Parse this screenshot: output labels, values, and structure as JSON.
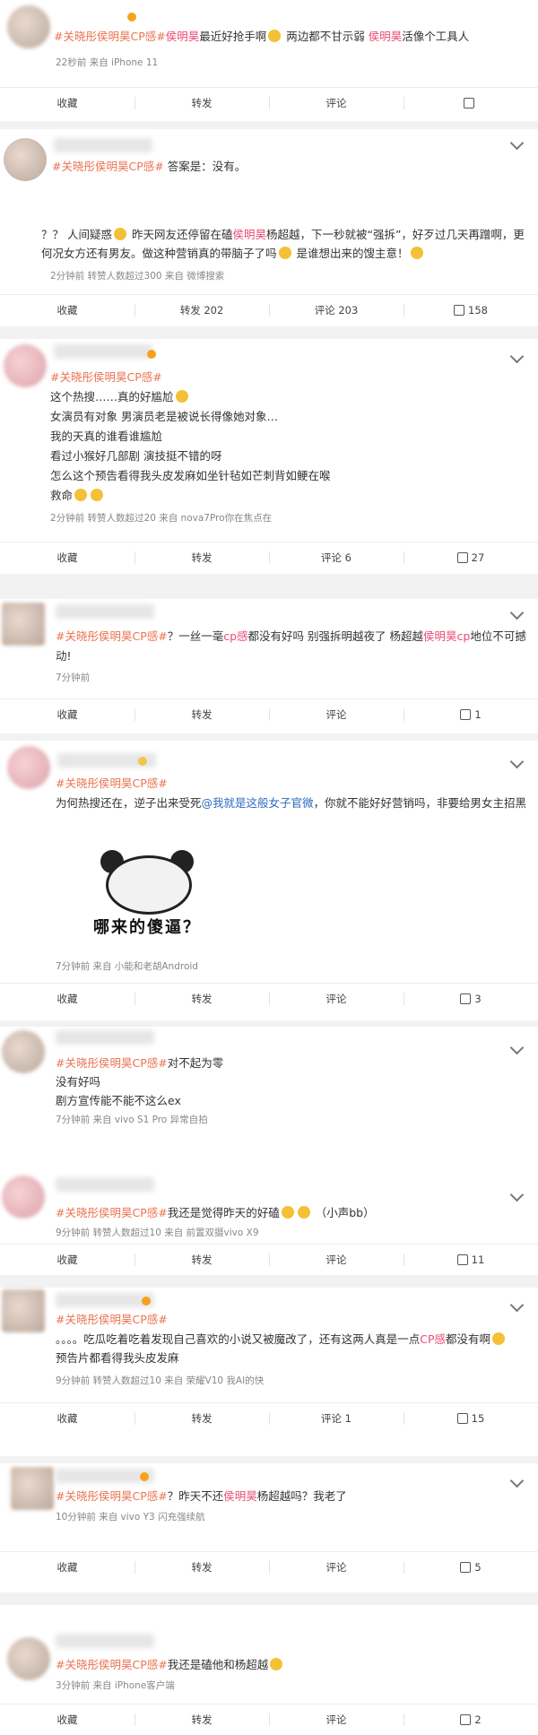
{
  "actions": {
    "collect": "收藏",
    "forward": "转发",
    "comment": "评论"
  },
  "posts": [
    {
      "text": [
        {
          "t": "#关晓彤侯明昊CP感#",
          "c": "tag"
        },
        {
          "t": "侯明昊",
          "c": "kw"
        },
        {
          "t": "最近好抢手啊",
          "c": ""
        },
        {
          "e": 1
        },
        {
          "t": " 两边都不甘示弱 ",
          "c": ""
        },
        {
          "t": "侯明昊",
          "c": "kw"
        },
        {
          "t": "活像个工具人",
          "c": ""
        }
      ],
      "meta": "22秒前  来自 iPhone 11",
      "forward": "转发",
      "comment": "评论",
      "like": ""
    },
    {
      "text": [
        {
          "t": "#关晓彤侯明昊CP感#",
          "c": "tag"
        },
        {
          "t": " 答案是：没有。",
          "c": ""
        }
      ],
      "body": [
        [
          {
            "t": "？？ 人间疑惑",
            "c": ""
          },
          {
            "e": 1
          },
          {
            "t": " 昨天网友还停留在磕",
            "c": ""
          },
          {
            "t": "侯明昊",
            "c": "kw"
          },
          {
            "t": "杨超越，下一秒就被“强拆”，好歹过几天再蹭啊，更",
            "c": ""
          }
        ],
        [
          {
            "t": "何况女方还有男友。做这种营销真的带脑子了吗",
            "c": ""
          },
          {
            "e": 1
          },
          {
            "t": " 是谁想出来的馊主意！",
            "c": ""
          },
          {
            "e": 1
          }
        ]
      ],
      "meta": "2分钟前  转赞人数超过300  来自 微博搜索",
      "forward": "转发 202",
      "comment": "评论 203",
      "like": "158"
    },
    {
      "text": [
        {
          "t": "#关晓彤侯明昊CP感#",
          "c": "tag"
        }
      ],
      "body": [
        [
          {
            "t": "这个热搜……真的好尴尬",
            "c": ""
          },
          {
            "e": 1
          }
        ],
        [
          {
            "t": "女演员有对象 男演员老是被说长得像她对象…",
            "c": ""
          }
        ],
        [
          {
            "t": "我的天真的谁看谁尴尬",
            "c": ""
          }
        ],
        [
          {
            "t": "看过小猴好几部剧 演技挺不错的呀",
            "c": ""
          }
        ],
        [
          {
            "t": "怎么这个预告看得我头皮发麻如坐针毡如芒刺背如鲠在喉",
            "c": ""
          }
        ],
        [
          {
            "t": "救命",
            "c": ""
          },
          {
            "e": 1
          },
          {
            "e": 1
          }
        ]
      ],
      "meta": "2分钟前  转赞人数超过20  来自 nova7Pro你在焦点在",
      "forward": "转发",
      "comment": "评论 6",
      "like": "27"
    },
    {
      "text": [
        {
          "t": "#关晓彤侯明昊CP感#",
          "c": "tag"
        },
        {
          "t": "？一丝一毫",
          "c": ""
        },
        {
          "t": "cp感",
          "c": "kw"
        },
        {
          "t": "都没有好吗 别强拆明越夜了 杨超越",
          "c": ""
        },
        {
          "t": "侯明昊cp",
          "c": "kw"
        },
        {
          "t": "地位不可撼",
          "c": ""
        }
      ],
      "body": [
        [
          {
            "t": "动!",
            "c": ""
          }
        ]
      ],
      "meta": "7分钟前",
      "forward": "转发",
      "comment": "评论",
      "like": "1"
    },
    {
      "text": [
        {
          "t": "#关晓彤侯明昊CP感#",
          "c": "tag"
        }
      ],
      "body": [
        [
          {
            "t": "为何热搜还在，逆子出来受死",
            "c": ""
          },
          {
            "t": "@我就是这般女子官微",
            "c": "at"
          },
          {
            "t": "，你就不能好好营销吗，非要给男女主招黑",
            "c": ""
          }
        ]
      ],
      "meme": "哪来的傻逼？",
      "meta": "7分钟前  来自 小能和老胡Android",
      "forward": "转发",
      "comment": "评论",
      "like": "3"
    },
    {
      "text": [
        {
          "t": "#关晓彤侯明昊CP感#",
          "c": "tag"
        },
        {
          "t": "对不起为零",
          "c": ""
        }
      ],
      "body": [
        [
          {
            "t": "没有好吗",
            "c": ""
          }
        ],
        [
          {
            "t": "剧方宣传能不能不这么ex",
            "c": ""
          }
        ]
      ],
      "meta": "7分钟前  来自 vivo S1 Pro 异常自拍"
    },
    {
      "text": [
        {
          "t": "#关晓彤侯明昊CP感#",
          "c": "tag"
        },
        {
          "t": "我还是觉得昨天的好磕",
          "c": ""
        },
        {
          "e": 1
        },
        {
          "e": 1
        },
        {
          "t": " （小声bb）",
          "c": ""
        }
      ],
      "meta": "9分钟前  转赞人数超过10  来自 前置双摄vivo X9",
      "forward": "转发",
      "comment": "评论",
      "like": "11"
    },
    {
      "text": [
        {
          "t": "#关晓彤侯明昊CP感#",
          "c": "tag"
        }
      ],
      "body": [
        [
          {
            "t": "。。。。吃瓜吃着吃着发现自己喜欢的小说又被魔改了，还有这两人真是一点",
            "c": ""
          },
          {
            "t": "CP感",
            "c": "kw"
          },
          {
            "t": "都没有啊",
            "c": ""
          },
          {
            "e": 1
          }
        ],
        [
          {
            "t": "预告片都看得我头皮发麻",
            "c": ""
          }
        ]
      ],
      "meta": "9分钟前  转赞人数超过10  来自 荣耀V10 我AI的快",
      "forward": "转发",
      "comment": "评论 1",
      "like": "15"
    },
    {
      "text": [
        {
          "t": "#关晓彤侯明昊CP感#",
          "c": "tag"
        },
        {
          "t": "？昨天不还",
          "c": ""
        },
        {
          "t": "侯明昊",
          "c": "kw"
        },
        {
          "t": "杨超越吗？我老了",
          "c": ""
        }
      ],
      "meta": "10分钟前  来自 vivo Y3 闪充强续航",
      "forward": "转发",
      "comment": "评论",
      "like": "5"
    },
    {
      "text": [
        {
          "t": "#关晓彤侯明昊CP感#",
          "c": "tag"
        },
        {
          "t": "我还是磕他和杨超越",
          "c": ""
        },
        {
          "e": 1
        }
      ],
      "meta": "3分钟前  来自 iPhone客户端",
      "forward": "转发",
      "comment": "评论",
      "like": "2"
    }
  ]
}
